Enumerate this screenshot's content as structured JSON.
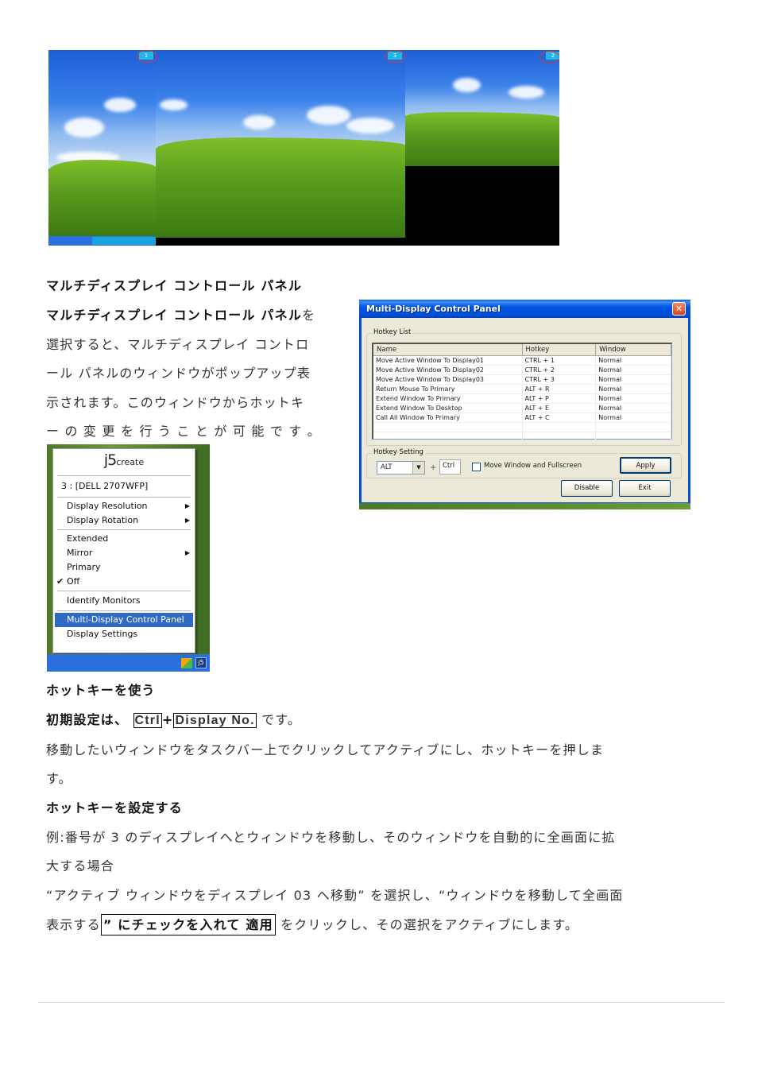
{
  "desktop_composite": {
    "monitor_labels": [
      "1",
      "3",
      "2"
    ],
    "highlight_color": "#d43a3a",
    "badge_color": "#21b6e8"
  },
  "section1": {
    "heading": "マルチディスプレイ コントロール パネル",
    "paragraph_lines": [
      {
        "bold": "マルチディスプレイ コントロール パネル",
        "normal": "を"
      },
      {
        "normal": "選択すると、マルチディスプレイ コントロ"
      },
      {
        "normal": "ール パネルのウィンドウがポップアップ表"
      },
      {
        "normal": "示されます。このウィンドウからホットキ"
      },
      {
        "normal": "ー の 変 更 を 行 う こ と が 可 能 で す 。"
      }
    ]
  },
  "context_menu": {
    "logo_main": "j5",
    "logo_sub": "create",
    "display_item": "3 : [DELL 2707WFP]",
    "items": [
      {
        "label": "Display Resolution",
        "submenu": true
      },
      {
        "label": "Display Rotation",
        "submenu": true
      },
      {
        "label": "Extended",
        "submenu": false
      },
      {
        "label": "Mirror",
        "submenu": true
      },
      {
        "label": "Primary",
        "submenu": false
      },
      {
        "label": "Off",
        "checked": true
      },
      {
        "label": "Identify Monitors"
      },
      {
        "label": "Multi-Display Control Panel",
        "highlighted": true
      },
      {
        "label": "Display Settings"
      }
    ],
    "tray_icon_label": "j5",
    "highlight_color": "#316ac5"
  },
  "dialog": {
    "title": "Multi-Display Control Panel",
    "close_glyph": "✕",
    "hotkey_list_label": "Hotkey List",
    "columns": [
      "Name",
      "Hotkey",
      "Window"
    ],
    "rows": [
      [
        "Move Active Window To Display01",
        "CTRL + 1",
        "Normal"
      ],
      [
        "Move Active Window To Display02",
        "CTRL + 2",
        "Normal"
      ],
      [
        "Move Active Window To Display03",
        "CTRL + 3",
        "Normal"
      ],
      [
        "Return Mouse To Primary",
        "ALT + R",
        "Normal"
      ],
      [
        "Extend Window To Primary",
        "ALT + P",
        "Normal"
      ],
      [
        "Extend Window To Desktop",
        "ALT + E",
        "Normal"
      ],
      [
        "Call All Window To Primary",
        "ALT + C",
        "Normal"
      ]
    ],
    "hotkey_setting_label": "Hotkey Setting",
    "modifier_value": "ALT",
    "plus": "+",
    "key_value": "Ctrl",
    "checkbox_label": "Move Window and Fullscreen",
    "checkbox_checked": false,
    "apply_label": "Apply",
    "disable_label": "Disable",
    "exit_label": "Exit"
  },
  "section2": {
    "heading": "ホットキーを使う",
    "default_prefix": "初期設定は、",
    "default_key1": "Ctrl",
    "default_plus": "+",
    "default_key2": "Display No.",
    "default_suffix": "です。",
    "instruction_line1": "移動したいウィンドウをタスクバー上でクリックしてアクティブにし、ホットキーを押しま",
    "instruction_line2": "す。"
  },
  "section3": {
    "heading": "ホットキーを設定する",
    "example_line1": "例:番号が 3 のディスプレイへとウィンドウを移動し、そのウィンドウを自動的に全画面に拡",
    "example_line2": "大する場合",
    "step_line1": "“アクティブ ウィンドウをディスプレイ 03 へ移動” を選択し、“ウィンドウを移動して全画面",
    "step_line2_prefix": "表示する",
    "step_line2_boxed": "” にチェックを入れて 適用",
    "step_line2_suffix": " をクリックし、その選択をアクティブにします。"
  }
}
